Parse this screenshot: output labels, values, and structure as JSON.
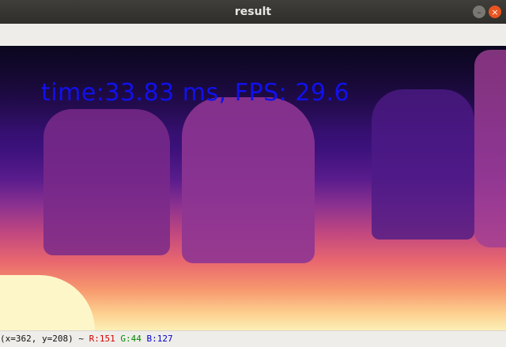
{
  "window": {
    "title": "result",
    "minimize_glyph": "–",
    "close_glyph": "×"
  },
  "image": {
    "overlay_text": "time:33.83 ms, FPS: 29.6",
    "overlay_color": "#1111ee"
  },
  "status": {
    "coords": "(x=362, y=208) ~",
    "r_label": "R:151",
    "g_label": "G:44",
    "b_label": "B:127"
  },
  "colors": {
    "titlebar": "#2f2e2b",
    "close": "#e95420",
    "r": "#d40000",
    "g": "#008a00",
    "b": "#0000cc"
  },
  "icons": [
    "minimize-icon",
    "close-icon"
  ]
}
